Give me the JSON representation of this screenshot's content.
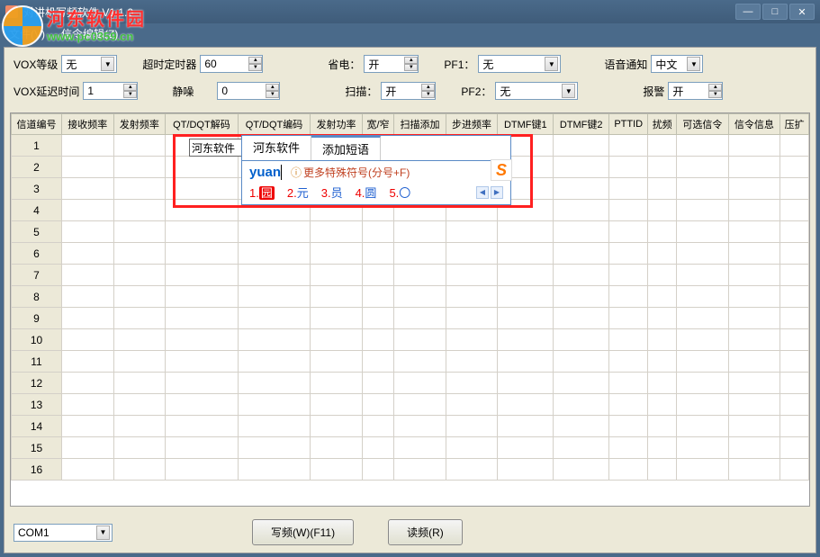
{
  "window": {
    "title": "对讲机写频软件 V1.1.0"
  },
  "menu": {
    "file": "文件(V)",
    "edit": "信令编辑(Z)"
  },
  "params": {
    "vox_level_label": "VOX等级",
    "vox_level_value": "无",
    "timeout_label": "超时定时器",
    "timeout_value": "60",
    "powersave_label": "省电：",
    "powersave_value": "开",
    "pf1_label": "PF1：",
    "pf1_value": "无",
    "voice_label": "语音通知",
    "voice_value": "中文",
    "vox_delay_label": "VOX延迟时间",
    "vox_delay_value": "1",
    "squelch_label": "静噪",
    "squelch_value": "0",
    "scan_label": "扫描：",
    "scan_value": "开",
    "pf2_label": "PF2：",
    "pf2_value": "无",
    "alarm_label": "报警",
    "alarm_value": "开"
  },
  "table": {
    "headers": [
      "信道编号",
      "接收频率",
      "发射频率",
      "QT/DQT解码",
      "QT/DQT编码",
      "发射功率",
      "宽/窄",
      "扫描添加",
      "步进频率",
      "DTMF键1",
      "DTMF键2",
      "PTTID",
      "扰频",
      "可选信令",
      "信令信息",
      "压扩"
    ],
    "rows": 16
  },
  "cell_edit": {
    "value": "河东软件"
  },
  "ime": {
    "tab1": "河东软件",
    "tab2": "添加短语",
    "input": "yuan",
    "hint": "更多特殊符号(分号+F)",
    "candidates": [
      {
        "num": "1.",
        "ch": "园",
        "sel": true
      },
      {
        "num": "2.",
        "ch": "元"
      },
      {
        "num": "3.",
        "ch": "员"
      },
      {
        "num": "4.",
        "ch": "圆"
      },
      {
        "num": "5.",
        "ch": "〇"
      }
    ]
  },
  "footer": {
    "port_value": "COM1",
    "write_btn": "写频(W)(F11)",
    "read_btn": "读频(R)"
  },
  "watermark": {
    "cn": "河东软件园",
    "url": "www.pc0359.cn"
  }
}
